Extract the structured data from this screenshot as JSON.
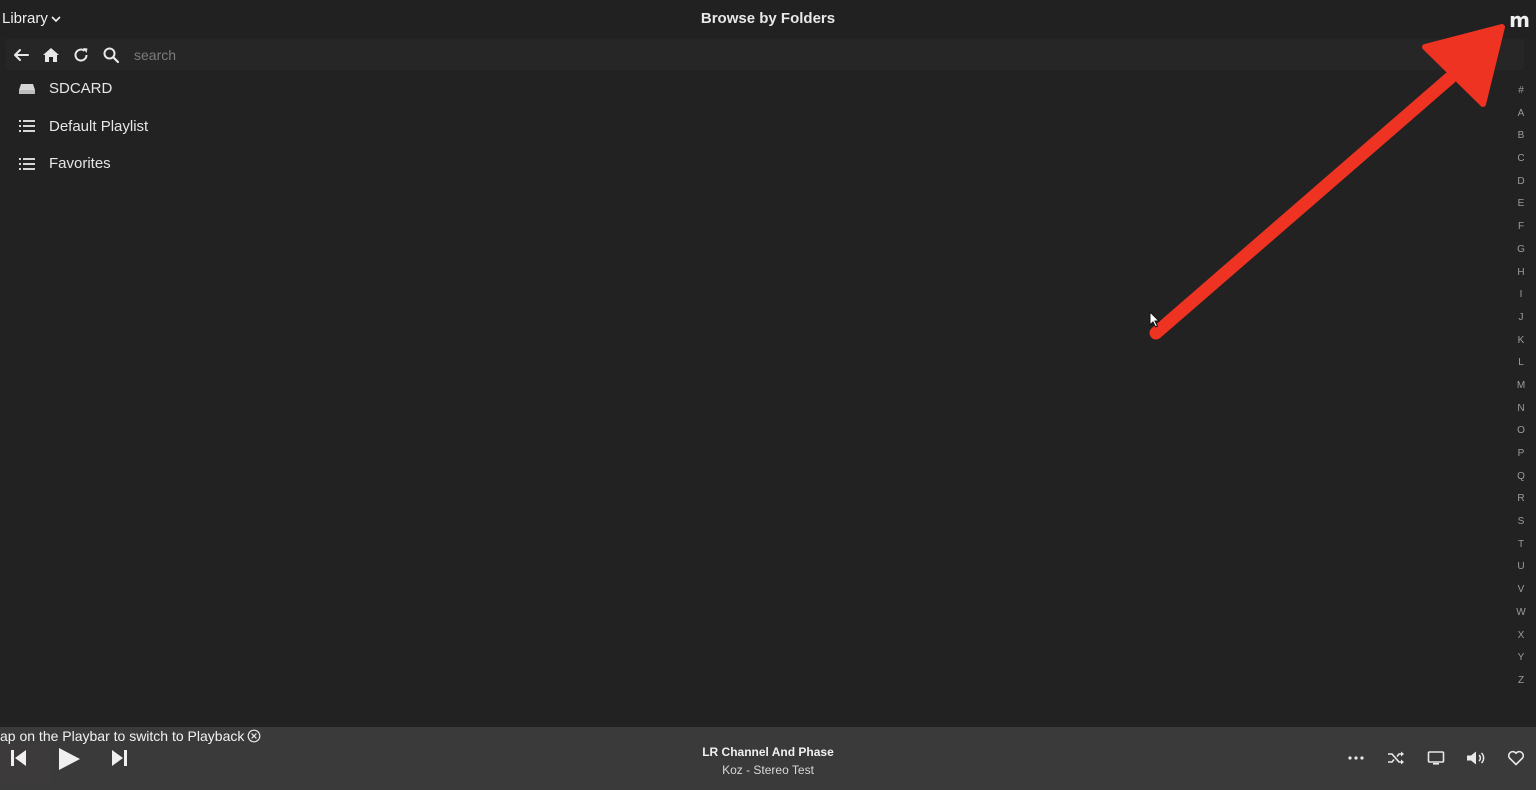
{
  "header": {
    "library_label": "Library",
    "title": "Browse by Folders",
    "logo": "m"
  },
  "toolbar": {
    "search_placeholder": "search",
    "icons": [
      "back-arrow-icon",
      "home-icon",
      "refresh-icon",
      "search-icon"
    ]
  },
  "list": {
    "items": [
      {
        "label": "SDCARD",
        "icon": "drive-icon"
      },
      {
        "label": "Default Playlist",
        "icon": "list-icon"
      },
      {
        "label": "Favorites",
        "icon": "list-icon"
      }
    ]
  },
  "alphabet": [
    "#",
    "A",
    "B",
    "C",
    "D",
    "E",
    "F",
    "G",
    "H",
    "I",
    "J",
    "K",
    "L",
    "M",
    "N",
    "O",
    "P",
    "Q",
    "R",
    "S",
    "T",
    "U",
    "V",
    "W",
    "X",
    "Y",
    "Z"
  ],
  "toast": {
    "text": "ap on the Playbar to switch to Playback"
  },
  "playbar": {
    "track_title": "LR Channel And Phase",
    "track_subtitle": "Koz - Stereo Test",
    "right_icons": [
      "more-icon",
      "shuffle-icon",
      "display-icon",
      "volume-icon",
      "heart-icon"
    ]
  },
  "colors": {
    "background": "#222222",
    "toolbar": "#262626",
    "playbar": "#3a3a3a",
    "annotation_arrow": "#ee3322"
  }
}
